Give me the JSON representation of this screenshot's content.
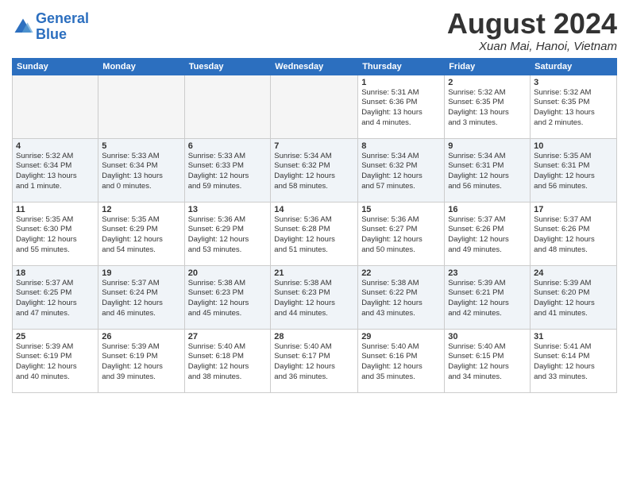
{
  "logo": {
    "line1": "General",
    "line2": "Blue"
  },
  "title": "August 2024",
  "location": "Xuan Mai, Hanoi, Vietnam",
  "weekdays": [
    "Sunday",
    "Monday",
    "Tuesday",
    "Wednesday",
    "Thursday",
    "Friday",
    "Saturday"
  ],
  "weeks": [
    [
      {
        "day": "",
        "info": ""
      },
      {
        "day": "",
        "info": ""
      },
      {
        "day": "",
        "info": ""
      },
      {
        "day": "",
        "info": ""
      },
      {
        "day": "1",
        "info": "Sunrise: 5:31 AM\nSunset: 6:36 PM\nDaylight: 13 hours\nand 4 minutes."
      },
      {
        "day": "2",
        "info": "Sunrise: 5:32 AM\nSunset: 6:35 PM\nDaylight: 13 hours\nand 3 minutes."
      },
      {
        "day": "3",
        "info": "Sunrise: 5:32 AM\nSunset: 6:35 PM\nDaylight: 13 hours\nand 2 minutes."
      }
    ],
    [
      {
        "day": "4",
        "info": "Sunrise: 5:32 AM\nSunset: 6:34 PM\nDaylight: 13 hours\nand 1 minute."
      },
      {
        "day": "5",
        "info": "Sunrise: 5:33 AM\nSunset: 6:34 PM\nDaylight: 13 hours\nand 0 minutes."
      },
      {
        "day": "6",
        "info": "Sunrise: 5:33 AM\nSunset: 6:33 PM\nDaylight: 12 hours\nand 59 minutes."
      },
      {
        "day": "7",
        "info": "Sunrise: 5:34 AM\nSunset: 6:32 PM\nDaylight: 12 hours\nand 58 minutes."
      },
      {
        "day": "8",
        "info": "Sunrise: 5:34 AM\nSunset: 6:32 PM\nDaylight: 12 hours\nand 57 minutes."
      },
      {
        "day": "9",
        "info": "Sunrise: 5:34 AM\nSunset: 6:31 PM\nDaylight: 12 hours\nand 56 minutes."
      },
      {
        "day": "10",
        "info": "Sunrise: 5:35 AM\nSunset: 6:31 PM\nDaylight: 12 hours\nand 56 minutes."
      }
    ],
    [
      {
        "day": "11",
        "info": "Sunrise: 5:35 AM\nSunset: 6:30 PM\nDaylight: 12 hours\nand 55 minutes."
      },
      {
        "day": "12",
        "info": "Sunrise: 5:35 AM\nSunset: 6:29 PM\nDaylight: 12 hours\nand 54 minutes."
      },
      {
        "day": "13",
        "info": "Sunrise: 5:36 AM\nSunset: 6:29 PM\nDaylight: 12 hours\nand 53 minutes."
      },
      {
        "day": "14",
        "info": "Sunrise: 5:36 AM\nSunset: 6:28 PM\nDaylight: 12 hours\nand 51 minutes."
      },
      {
        "day": "15",
        "info": "Sunrise: 5:36 AM\nSunset: 6:27 PM\nDaylight: 12 hours\nand 50 minutes."
      },
      {
        "day": "16",
        "info": "Sunrise: 5:37 AM\nSunset: 6:26 PM\nDaylight: 12 hours\nand 49 minutes."
      },
      {
        "day": "17",
        "info": "Sunrise: 5:37 AM\nSunset: 6:26 PM\nDaylight: 12 hours\nand 48 minutes."
      }
    ],
    [
      {
        "day": "18",
        "info": "Sunrise: 5:37 AM\nSunset: 6:25 PM\nDaylight: 12 hours\nand 47 minutes."
      },
      {
        "day": "19",
        "info": "Sunrise: 5:37 AM\nSunset: 6:24 PM\nDaylight: 12 hours\nand 46 minutes."
      },
      {
        "day": "20",
        "info": "Sunrise: 5:38 AM\nSunset: 6:23 PM\nDaylight: 12 hours\nand 45 minutes."
      },
      {
        "day": "21",
        "info": "Sunrise: 5:38 AM\nSunset: 6:23 PM\nDaylight: 12 hours\nand 44 minutes."
      },
      {
        "day": "22",
        "info": "Sunrise: 5:38 AM\nSunset: 6:22 PM\nDaylight: 12 hours\nand 43 minutes."
      },
      {
        "day": "23",
        "info": "Sunrise: 5:39 AM\nSunset: 6:21 PM\nDaylight: 12 hours\nand 42 minutes."
      },
      {
        "day": "24",
        "info": "Sunrise: 5:39 AM\nSunset: 6:20 PM\nDaylight: 12 hours\nand 41 minutes."
      }
    ],
    [
      {
        "day": "25",
        "info": "Sunrise: 5:39 AM\nSunset: 6:19 PM\nDaylight: 12 hours\nand 40 minutes."
      },
      {
        "day": "26",
        "info": "Sunrise: 5:39 AM\nSunset: 6:19 PM\nDaylight: 12 hours\nand 39 minutes."
      },
      {
        "day": "27",
        "info": "Sunrise: 5:40 AM\nSunset: 6:18 PM\nDaylight: 12 hours\nand 38 minutes."
      },
      {
        "day": "28",
        "info": "Sunrise: 5:40 AM\nSunset: 6:17 PM\nDaylight: 12 hours\nand 36 minutes."
      },
      {
        "day": "29",
        "info": "Sunrise: 5:40 AM\nSunset: 6:16 PM\nDaylight: 12 hours\nand 35 minutes."
      },
      {
        "day": "30",
        "info": "Sunrise: 5:40 AM\nSunset: 6:15 PM\nDaylight: 12 hours\nand 34 minutes."
      },
      {
        "day": "31",
        "info": "Sunrise: 5:41 AM\nSunset: 6:14 PM\nDaylight: 12 hours\nand 33 minutes."
      }
    ]
  ]
}
